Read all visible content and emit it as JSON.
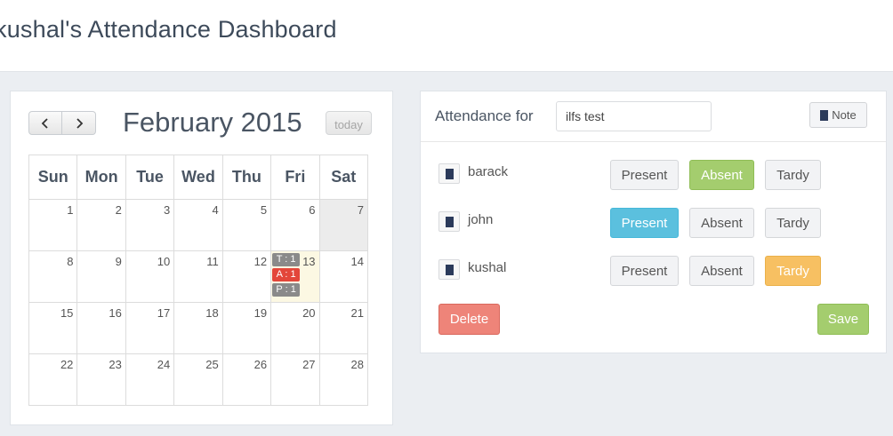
{
  "header": {
    "title": "kushal's Attendance Dashboard"
  },
  "calendar": {
    "title": "February 2015",
    "prev_icon": "chevron-left-icon",
    "next_icon": "chevron-right-icon",
    "today_label": "today",
    "weekdays": [
      "Sun",
      "Mon",
      "Tue",
      "Wed",
      "Thu",
      "Fri",
      "Sat"
    ],
    "weeks": [
      [
        "1",
        "2",
        "3",
        "4",
        "5",
        "6",
        "7"
      ],
      [
        "8",
        "9",
        "10",
        "11",
        "12",
        "13",
        "14"
      ],
      [
        "15",
        "16",
        "17",
        "18",
        "19",
        "20",
        "21"
      ],
      [
        "22",
        "23",
        "24",
        "25",
        "26",
        "27",
        "28"
      ]
    ],
    "events_day_13": [
      "T : 1",
      "A : 1",
      "P : 1"
    ]
  },
  "attendance": {
    "label": "Attendance for",
    "input_value": "ilfs test",
    "note_label": "Note",
    "present_label": "Present",
    "absent_label": "Absent",
    "tardy_label": "Tardy",
    "students": [
      {
        "name": "barack",
        "status": "Absent"
      },
      {
        "name": "john",
        "status": "Present"
      },
      {
        "name": "kushal",
        "status": "Tardy"
      }
    ],
    "delete_label": "Delete",
    "save_label": "Save"
  },
  "colors": {
    "present": "#5bc0de",
    "absent": "#a4cd6e",
    "tardy": "#f7c062",
    "delete": "#ee8479",
    "event_absent": "#e3463a",
    "event_other": "#8a8a8a"
  }
}
